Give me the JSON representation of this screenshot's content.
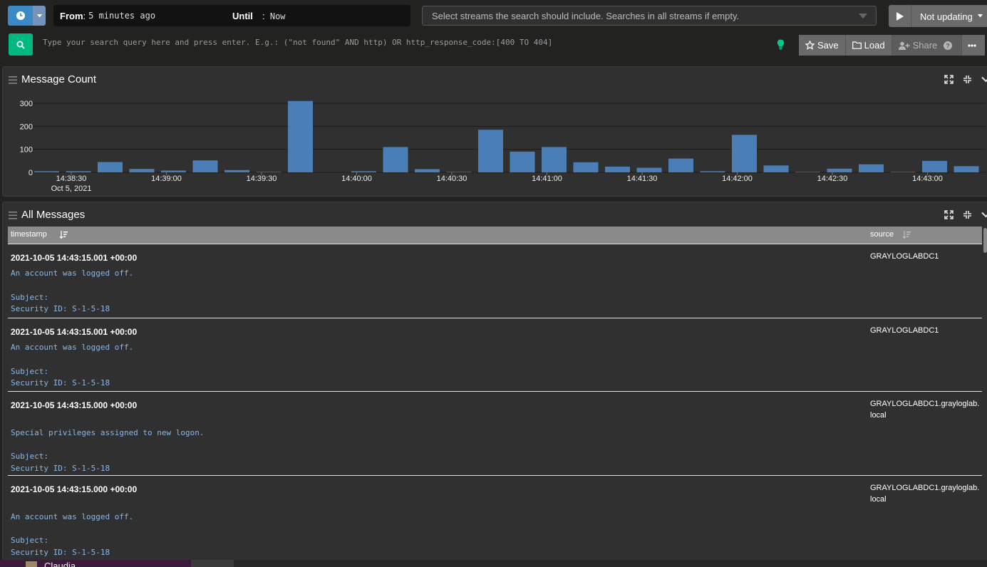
{
  "timerange": {
    "from_label": "From",
    "from_value": "5 minutes ago",
    "until_label": "Until",
    "until_value": "Now"
  },
  "streams": {
    "placeholder": "Select streams the search should include. Searches in all streams if empty."
  },
  "refresh": {
    "label": "Not updating"
  },
  "query": {
    "placeholder": "Type your search query here and press enter. E.g.: (\"not found\" AND http) OR http_response_code:[400 TO 404]"
  },
  "actions": {
    "save": "Save",
    "load": "Load",
    "share": "Share"
  },
  "colors": {
    "accent_blue": "#3c89c8",
    "search_green": "#00b980",
    "bar": "#4a7eb7",
    "link_text": "#8ab7e8"
  },
  "widgets": {
    "message_count": {
      "title": "Message Count"
    },
    "all_messages": {
      "title": "All Messages",
      "columns": [
        "timestamp",
        "source"
      ],
      "rows": [
        {
          "timestamp": "2021-10-05 14:43:15.001 +00:00",
          "source": "GRAYLOGLABDC1",
          "lines": [
            "An account was logged off.",
            "",
            "Subject:",
            "Security ID: S-1-5-18"
          ]
        },
        {
          "timestamp": "2021-10-05 14:43:15.001 +00:00",
          "source": "GRAYLOGLABDC1",
          "lines": [
            "An account was logged off.",
            "",
            "Subject:",
            "Security ID: S-1-5-18"
          ]
        },
        {
          "timestamp": "2021-10-05 14:43:15.000 +00:00",
          "source": "GRAYLOGLABDC1.grayloglab.local",
          "lines": [
            "",
            "Special privileges assigned to new logon.",
            "",
            "Subject:",
            "Security ID: S-1-5-18"
          ]
        },
        {
          "timestamp": "2021-10-05 14:43:15.000 +00:00",
          "source": "GRAYLOGLABDC1.grayloglab.local",
          "lines": [
            "",
            "An account was logged off.",
            "",
            "Subject:",
            "Security ID: S-1-5-18"
          ]
        }
      ]
    }
  },
  "bottom": {
    "user": "Claudia"
  },
  "chart_data": {
    "type": "bar",
    "title": "Message Count",
    "x": [
      "14:38:10",
      "14:38:20",
      "14:38:30",
      "14:38:40",
      "14:38:50",
      "14:39:00",
      "14:39:10",
      "14:39:20",
      "14:39:30",
      "14:39:40",
      "14:39:50",
      "14:40:00",
      "14:40:10",
      "14:40:20",
      "14:40:30",
      "14:40:40",
      "14:40:50",
      "14:41:00",
      "14:41:10",
      "14:41:20",
      "14:41:30",
      "14:41:40",
      "14:41:50",
      "14:42:00",
      "14:42:10",
      "14:42:20",
      "14:42:30",
      "14:42:40",
      "14:42:50",
      "14:43:00",
      "14:43:10"
    ],
    "values": [
      5,
      5,
      45,
      15,
      8,
      52,
      10,
      2,
      310,
      0,
      5,
      110,
      14,
      2,
      185,
      90,
      110,
      44,
      25,
      20,
      60,
      5,
      163,
      30,
      2,
      16,
      35,
      2,
      50,
      27,
      0
    ],
    "xticks": [
      "14:38:30",
      "14:39:00",
      "14:39:30",
      "14:40:00",
      "14:40:30",
      "14:41:00",
      "14:41:30",
      "14:42:00",
      "14:42:30",
      "14:43:00"
    ],
    "xtick_sub": "Oct 5, 2021",
    "yticks": [
      0,
      100,
      200,
      300
    ],
    "ylim": [
      0,
      320
    ],
    "grid": true
  }
}
